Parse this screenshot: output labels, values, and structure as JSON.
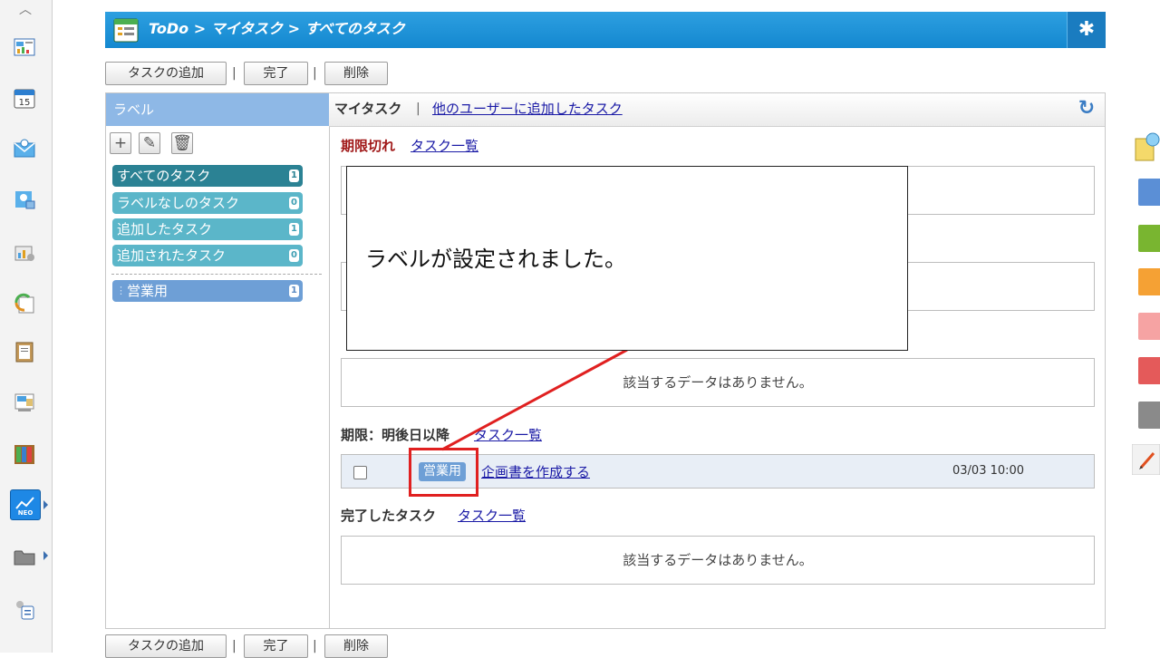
{
  "breadcrumb": "ToDo > マイタスク > すべてのタスク",
  "toolbar": {
    "add_label": "タスクの追加",
    "sep": "|",
    "complete_label": "完了",
    "delete_label": "削除"
  },
  "labels_panel": {
    "title": "ラベル",
    "items": [
      {
        "label": "すべてのタスク",
        "count": "1"
      },
      {
        "label": "ラベルなしのタスク",
        "count": "0"
      },
      {
        "label": "追加したタスク",
        "count": "1"
      },
      {
        "label": "追加されたタスク",
        "count": "0"
      },
      {
        "label": "営業用",
        "count": "1"
      }
    ]
  },
  "tabs": {
    "mine": "マイタスク",
    "sep": "|",
    "other": "他のユーザーに追加したタスク"
  },
  "sections": {
    "overdue": {
      "title": "期限切れ",
      "link": "タスク一覧"
    },
    "after": {
      "title": "期限：明後日以降",
      "link": "タスク一覧"
    },
    "done": {
      "title": "完了したタスク",
      "link": "タスク一覧"
    },
    "empty_text": "該当するデータはありません。"
  },
  "task": {
    "tag": "営業用",
    "title": "企画書を作成する",
    "date": "03/03 10:00"
  },
  "callout": {
    "message": "ラベルが設定されました。"
  },
  "colors": {
    "header": "#1e93d8",
    "label_blue": "#6e9fd6",
    "highlight": "#e02020"
  }
}
